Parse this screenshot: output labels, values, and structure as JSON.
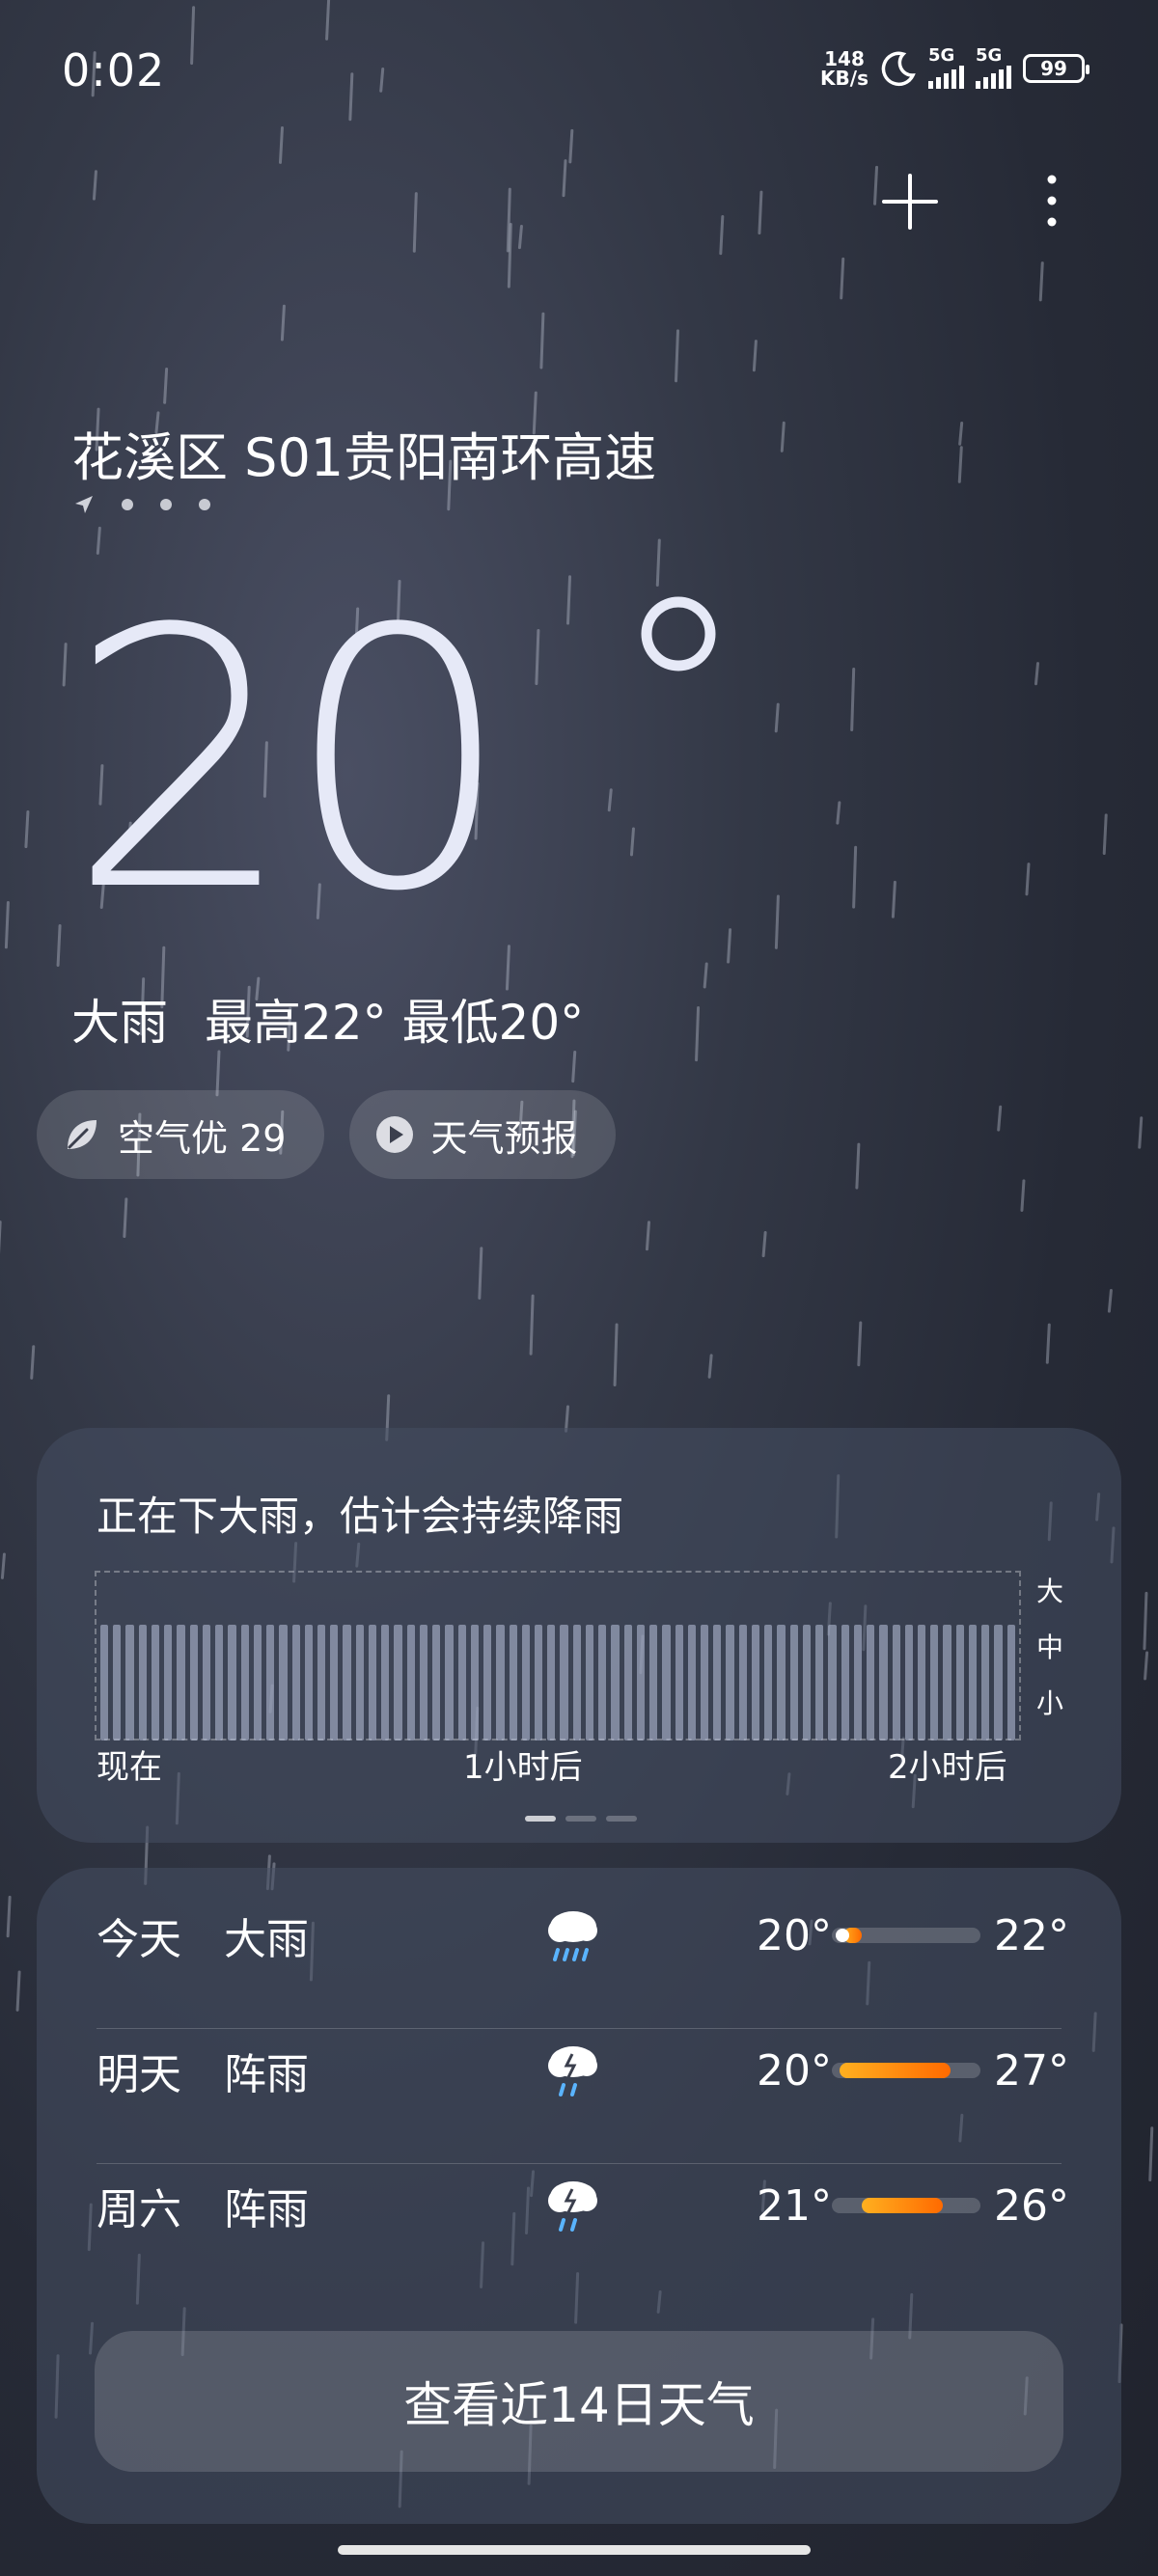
{
  "status_bar": {
    "time": "0:02",
    "net_speed_value": "148",
    "net_speed_unit": "KB/s",
    "sim1_label": "5G",
    "sim2_label": "5G",
    "battery": "99"
  },
  "location": "花溪区 S01贵阳南环高速",
  "current": {
    "temperature": "20",
    "condition": "大雨",
    "high": "最高22°",
    "low": "最低20°"
  },
  "chips": {
    "air_quality": "空气优 29",
    "forecast_video": "天气预报"
  },
  "precip_card": {
    "headline": "正在下大雨，估计会持续降雨",
    "levels": [
      "大",
      "中",
      "小"
    ],
    "ticks": [
      "现在",
      "1小时后",
      "2小时后"
    ]
  },
  "forecast": {
    "rows": [
      {
        "day": "今天",
        "desc": "大雨",
        "low": "20°",
        "high": "22°",
        "icon": "heavy-rain-icon",
        "range_fraction": [
          0.08,
          0.2
        ]
      },
      {
        "day": "明天",
        "desc": "阵雨",
        "low": "20°",
        "high": "27°",
        "icon": "shower-icon",
        "range_fraction": [
          0.05,
          0.8
        ]
      },
      {
        "day": "周六",
        "desc": "阵雨",
        "low": "21°",
        "high": "26°",
        "icon": "shower-icon",
        "range_fraction": [
          0.2,
          0.75
        ]
      }
    ],
    "button": "查看近14日天气"
  },
  "colors": {
    "accent_orange": "#ff8a00",
    "today_dot": "#ffffff"
  }
}
